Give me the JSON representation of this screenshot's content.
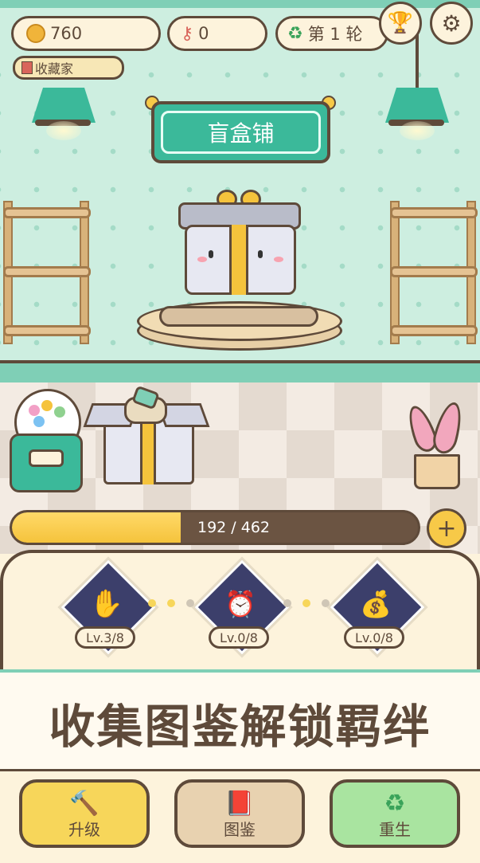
{
  "hud": {
    "coins": "760",
    "keys": "0",
    "round": "第 1 轮",
    "collector_tag": "收藏家"
  },
  "shop": {
    "sign": "盲盒铺"
  },
  "progress": {
    "text": "192 / 462",
    "current": 192,
    "max": 462,
    "plus_label": "+"
  },
  "upgrades": [
    {
      "icon": "hand-icon",
      "level": "Lv.3/8"
    },
    {
      "icon": "alarm-clock-icon",
      "level": "Lv.0/8"
    },
    {
      "icon": "money-bag-icon",
      "level": "Lv.0/8"
    }
  ],
  "banner": {
    "text": "收集图鉴解锁羁绊"
  },
  "bottom_nav": {
    "upgrade": "升级",
    "collection": "图鉴",
    "rebirth": "重生"
  },
  "colors": {
    "brown": "#5e4a3a",
    "teal": "#3bb99a",
    "yellow": "#f7c948",
    "wall": "#cdeee0"
  }
}
